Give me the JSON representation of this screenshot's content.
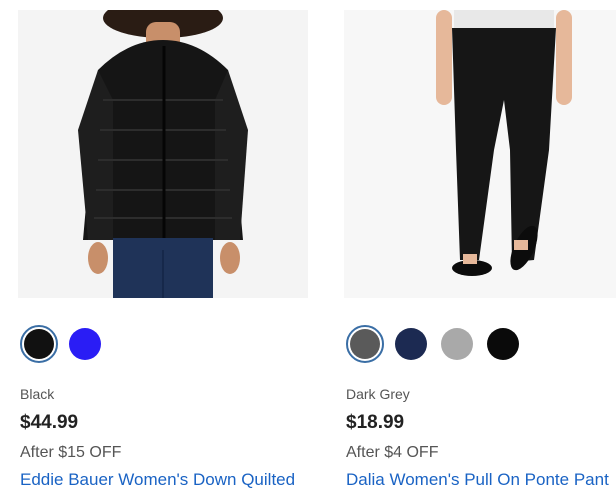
{
  "products": [
    {
      "image_alt": "Eddie Bauer Women's Down Quilted jacket",
      "swatches": [
        {
          "name": "Black",
          "color": "#111111",
          "selected": true
        },
        {
          "name": "Blue",
          "color": "#2a1df5",
          "selected": false
        }
      ],
      "color_name": "Black",
      "price": "$44.99",
      "discount": "After $15 OFF",
      "title": "Eddie Bauer Women's Down Quilted"
    },
    {
      "image_alt": "Dalia Women's Pull On Ponte Pant",
      "swatches": [
        {
          "name": "Dark Grey",
          "color": "#5a5a5a",
          "selected": true
        },
        {
          "name": "Navy",
          "color": "#1c2a52",
          "selected": false
        },
        {
          "name": "Light Grey",
          "color": "#a9a9a9",
          "selected": false
        },
        {
          "name": "Black",
          "color": "#0a0a0a",
          "selected": false
        }
      ],
      "color_name": "Dark Grey",
      "price": "$18.99",
      "discount": "After $4 OFF",
      "title": "Dalia Women's Pull On Ponte Pant"
    }
  ],
  "colors": {
    "link": "#1a63c4",
    "selected_ring": "#3a6ea5"
  }
}
